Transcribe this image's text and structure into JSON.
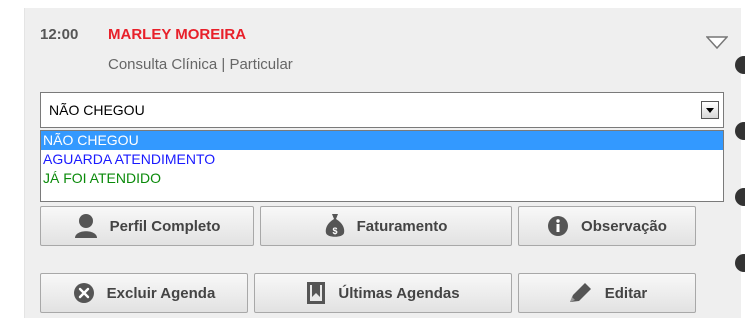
{
  "appointment": {
    "time": "12:00",
    "patient_name": "MARLEY MOREIRA",
    "subtitle": "Consulta Clínica | Particular"
  },
  "status_select": {
    "value": "NÃO CHEGOU",
    "options": [
      {
        "label": "NÃO CHEGOU",
        "color": "#ffffff",
        "selected": true
      },
      {
        "label": "AGUARDA ATENDIMENTO",
        "color": "#1a1aff",
        "selected": false
      },
      {
        "label": "JÁ FOI ATENDIDO",
        "color": "#0a8a0a",
        "selected": false
      }
    ]
  },
  "actions": {
    "profile": "Perfil Completo",
    "billing": "Faturamento",
    "notes": "Observação",
    "delete": "Excluir Agenda",
    "last": "Últimas Agendas",
    "edit": "Editar"
  },
  "icons": {
    "profile": "person-icon",
    "billing": "money-bag-icon",
    "notes": "info-icon",
    "delete": "close-circle-icon",
    "last": "bookmark-icon",
    "edit": "pencil-icon",
    "collapse": "triangle-down-icon"
  },
  "colors": {
    "patient_name": "#e8202a",
    "highlight": "#3399ff"
  }
}
